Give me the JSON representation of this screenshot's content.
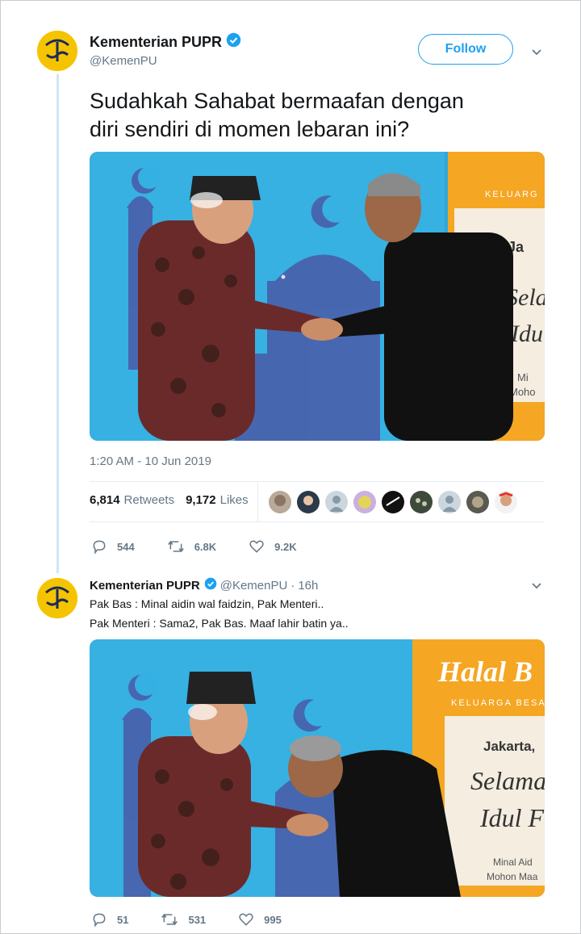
{
  "tweet": {
    "author_name": "Kementerian PUPR",
    "handle": "@KemenPU",
    "follow_label": "Follow",
    "text_line1": "Sudahkah Sahabat bermaafan dengan",
    "text_line2": "diri sendiri di momen lebaran ini?",
    "timestamp": "1:20 AM - 10 Jun 2019",
    "retweets_count": "6,814",
    "retweets_label": "Retweets",
    "likes_count": "9,172",
    "likes_label": "Likes",
    "likers_count_visible": 9,
    "replies": "544",
    "retweets_short": "6.8K",
    "likes_short": "9.2K",
    "photo_banner_text": {
      "line1": "KELUARG",
      "line2": "Ja",
      "line3": "Sela",
      "line4": "Idu",
      "line5": "Mi",
      "line6": "Moho"
    }
  },
  "reply": {
    "author_name": "Kementerian PUPR",
    "handle": "@KemenPU",
    "separator": "·",
    "time": "16h",
    "line1": "Pak Bas : Minal aidin wal faidzin, Pak Menteri..",
    "line2": "Pak Menteri : Sama2, Pak Bas. Maaf lahir batin ya..",
    "replies": "51",
    "retweets": "531",
    "likes": "995",
    "photo_banner_text": {
      "title": "Halal B",
      "subtitle": "KELUARGA BESAR",
      "city": "Jakarta,",
      "line1": "Selamat",
      "line2": "Idul F",
      "line3": "Minal Aid",
      "line4": "Mohon Maa"
    }
  },
  "colors": {
    "brand_blue": "#1da1f2",
    "text_gray": "#657786",
    "avatar_yellow": "#f5c400"
  }
}
